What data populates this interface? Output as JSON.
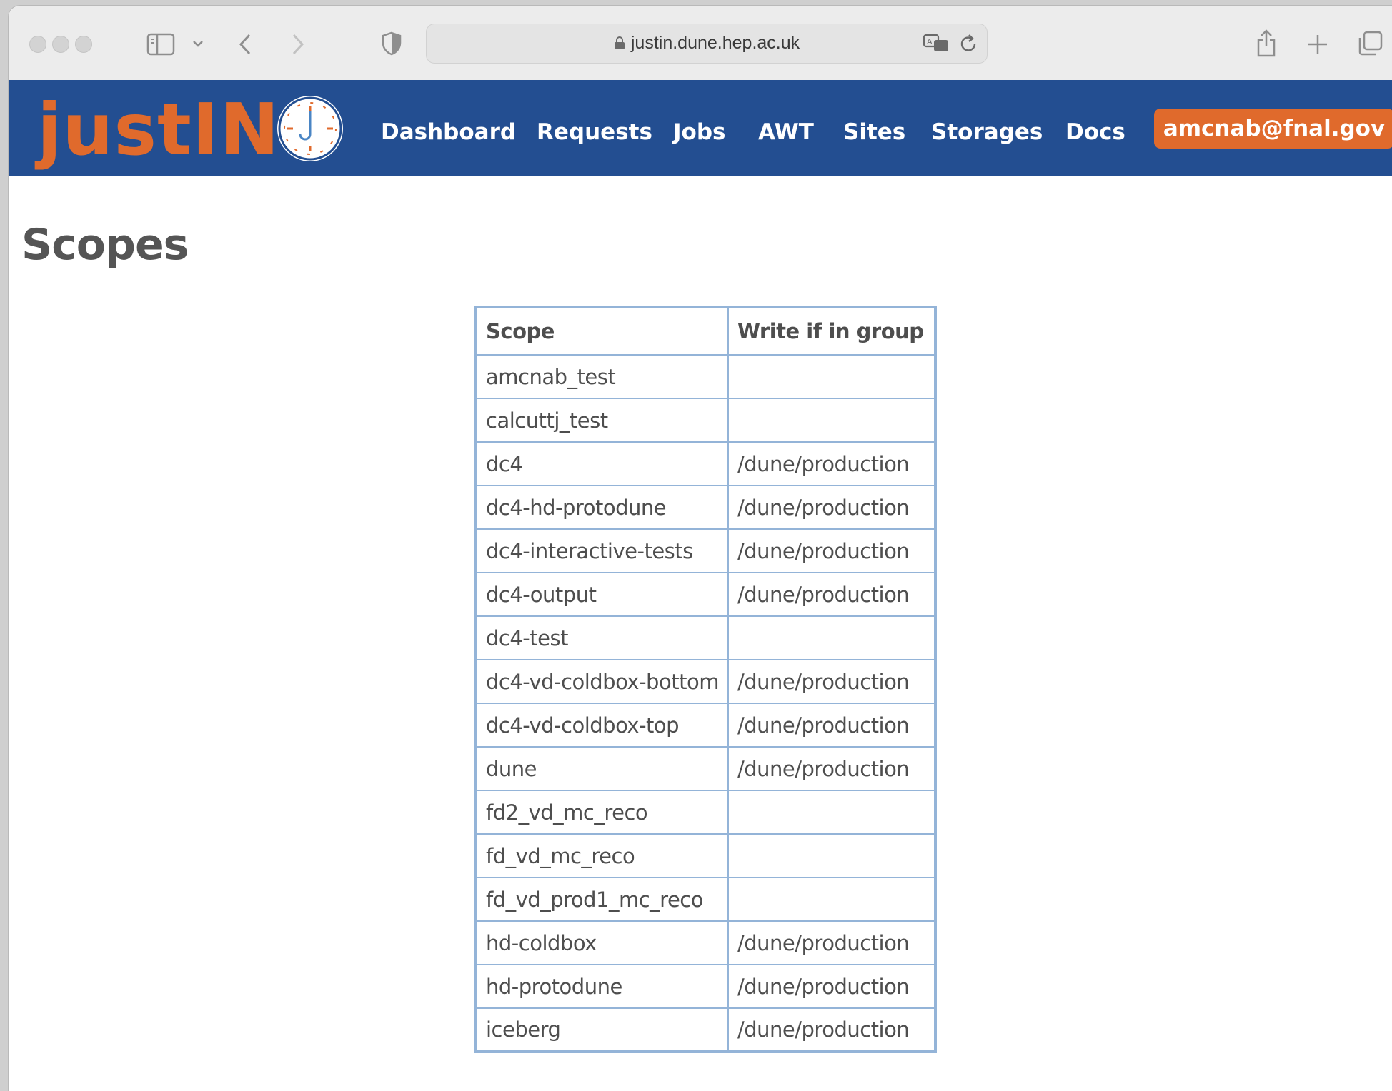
{
  "browser": {
    "url": "justin.dune.hep.ac.uk"
  },
  "site": {
    "logo": "justIN",
    "nav": [
      {
        "label": "Dashboard"
      },
      {
        "label": "Requests"
      },
      {
        "label": "Jobs"
      },
      {
        "label": "AWT"
      },
      {
        "label": "Sites"
      },
      {
        "label": "Storages"
      },
      {
        "label": "Docs"
      }
    ],
    "user": "amcnab@fnal.gov",
    "colors": {
      "header": "#234e91",
      "accent": "#e06a2c"
    }
  },
  "page": {
    "title": "Scopes"
  },
  "table": {
    "headers": [
      "Scope",
      "Write if in group"
    ],
    "rows": [
      [
        "amcnab_test",
        ""
      ],
      [
        "calcuttj_test",
        ""
      ],
      [
        "dc4",
        "/dune/production"
      ],
      [
        "dc4-hd-protodune",
        "/dune/production"
      ],
      [
        "dc4-interactive-tests",
        "/dune/production"
      ],
      [
        "dc4-output",
        "/dune/production"
      ],
      [
        "dc4-test",
        ""
      ],
      [
        "dc4-vd-coldbox-bottom",
        "/dune/production"
      ],
      [
        "dc4-vd-coldbox-top",
        "/dune/production"
      ],
      [
        "dune",
        "/dune/production"
      ],
      [
        "fd2_vd_mc_reco",
        ""
      ],
      [
        "fd_vd_mc_reco",
        ""
      ],
      [
        "fd_vd_prod1_mc_reco",
        ""
      ],
      [
        "hd-coldbox",
        "/dune/production"
      ],
      [
        "hd-protodune",
        "/dune/production"
      ],
      [
        "iceberg",
        "/dune/production"
      ]
    ]
  }
}
